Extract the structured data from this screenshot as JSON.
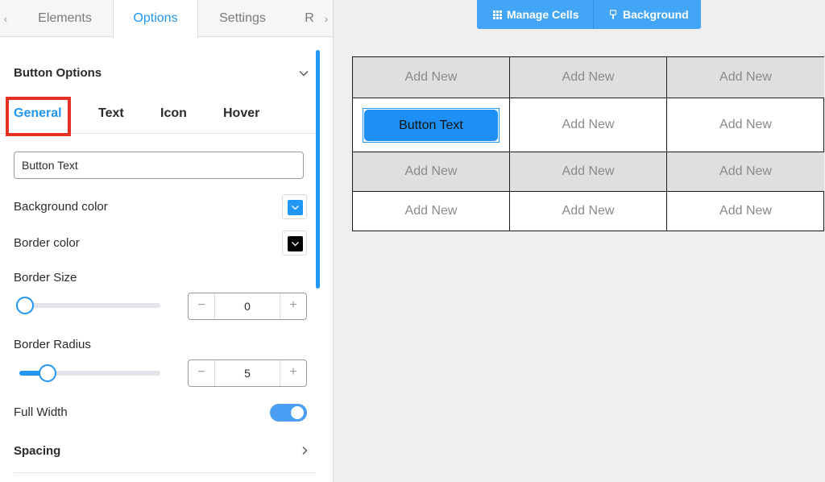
{
  "tabs": {
    "prev_arrow": "‹",
    "next_arrow": "›",
    "items": [
      {
        "label": "Elements"
      },
      {
        "label": "Options"
      },
      {
        "label": "Settings"
      },
      {
        "label": "R"
      }
    ],
    "active": "Options"
  },
  "section": {
    "title": "Button Options"
  },
  "subtabs": {
    "items": [
      {
        "label": "General"
      },
      {
        "label": "Text"
      },
      {
        "label": "Icon"
      },
      {
        "label": "Hover"
      }
    ],
    "active": "General"
  },
  "form": {
    "button_text_value": "Button Text",
    "background_color": {
      "label": "Background color",
      "value": "#2196f3"
    },
    "border_color": {
      "label": "Border color",
      "value": "#000000"
    },
    "border_size": {
      "label": "Border Size",
      "value": "0",
      "minus": "−",
      "plus": "+"
    },
    "border_radius": {
      "label": "Border Radius",
      "value": "5",
      "minus": "−",
      "plus": "+"
    },
    "full_width": {
      "label": "Full Width",
      "enabled": true
    },
    "spacing": {
      "label": "Spacing"
    }
  },
  "toolbar": {
    "manage_cells_label": "Manage Cells",
    "background_label": "Background"
  },
  "grid": {
    "cell_placeholder": "Add New",
    "selected_button_text": "Button Text"
  },
  "colors": {
    "accent": "#2196f3",
    "highlight": "#e53123",
    "toolbar": "#42a5f5"
  }
}
